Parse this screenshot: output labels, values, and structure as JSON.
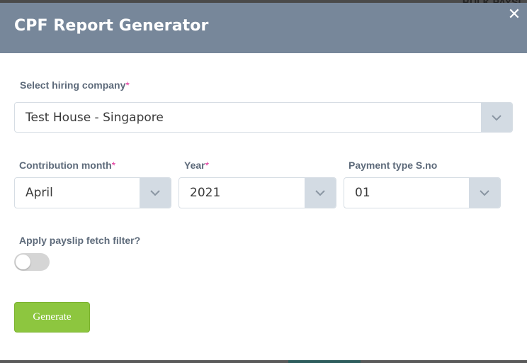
{
  "background": {
    "peek_text": "BULK PAYSL"
  },
  "modal": {
    "title": "CPF Report Generator",
    "close_glyph": "✕"
  },
  "form": {
    "company": {
      "label": "Select hiring company",
      "required_mark": "*",
      "value": "Test House - Singapore",
      "arrow_icon": "chevron-down-icon"
    },
    "month": {
      "label": "Contribution month",
      "required_mark": "*",
      "value": "April"
    },
    "year": {
      "label": "Year",
      "required_mark": "*",
      "value": "2021"
    },
    "payment_type": {
      "label": "Payment type S.no",
      "value": "01"
    },
    "filter": {
      "label": "Apply payslip fetch filter?",
      "enabled": false
    },
    "generate_label": "Generate"
  },
  "colors": {
    "header": "#77879a",
    "accent_green": "#8dc63f",
    "required": "#e0339a"
  }
}
